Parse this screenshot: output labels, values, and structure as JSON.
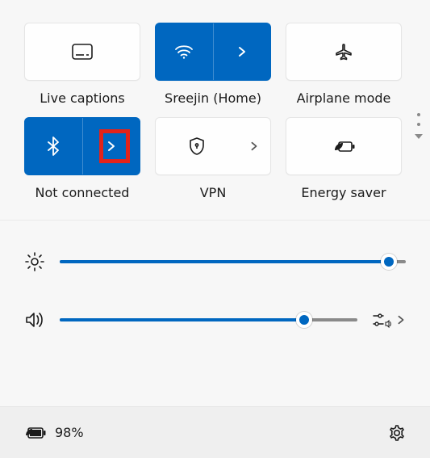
{
  "tiles": [
    {
      "label": "Live captions"
    },
    {
      "label": "Sreejin (Home)"
    },
    {
      "label": "Airplane mode"
    },
    {
      "label": "Not connected"
    },
    {
      "label": "VPN"
    },
    {
      "label": "Energy saver"
    }
  ],
  "sliders": {
    "brightness": {
      "percent": 95
    },
    "volume": {
      "percent": 82
    }
  },
  "footer": {
    "battery": "98%"
  },
  "colors": {
    "accent": "#0067c0",
    "highlight": "#e2231a"
  }
}
